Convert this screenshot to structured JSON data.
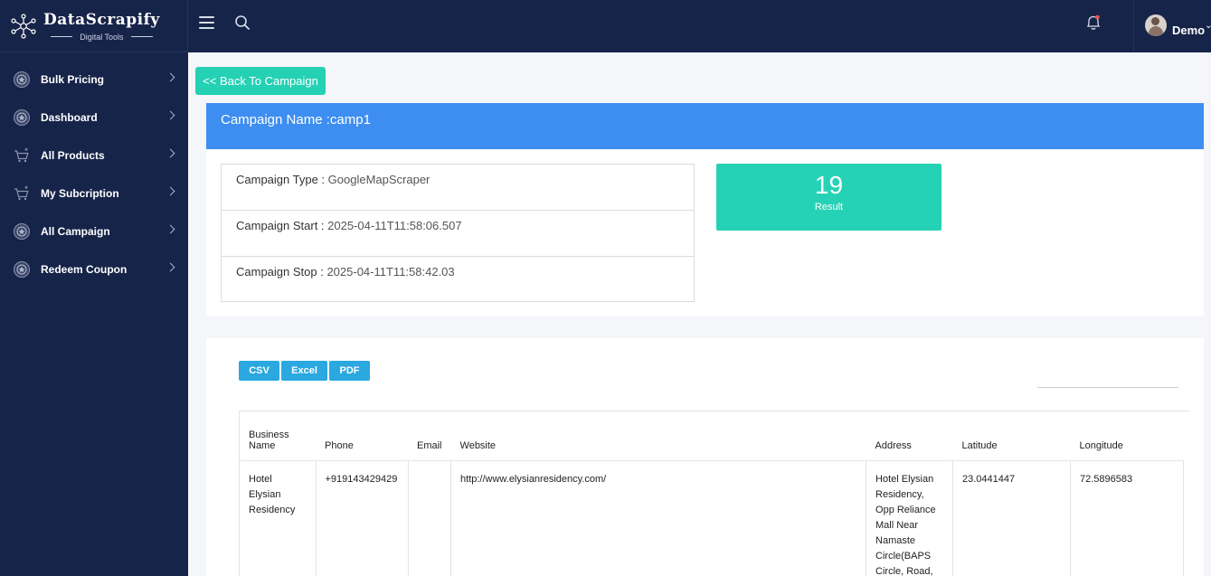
{
  "brand": {
    "name": "DataScrapify",
    "tagline": "Digital Tools"
  },
  "sidebar": {
    "items": [
      {
        "label": "Bulk Pricing",
        "icon": "badge-icon"
      },
      {
        "label": "Dashboard",
        "icon": "badge-icon"
      },
      {
        "label": "All Products",
        "icon": "cart-icon"
      },
      {
        "label": "My Subcription",
        "icon": "cart-icon"
      },
      {
        "label": "All Campaign",
        "icon": "badge-icon"
      },
      {
        "label": "Redeem Coupon",
        "icon": "badge-icon"
      }
    ]
  },
  "topbar": {
    "user_name": "Demo"
  },
  "back_button": "<< Back To Campaign",
  "campaign": {
    "header": "Campaign Name :camp1",
    "type_label": "Campaign Type : ",
    "type_value": "GoogleMapScraper",
    "start_label": "Campaign Start : ",
    "start_value": "2025-04-11T11:58:06.507",
    "stop_label": "Campaign Stop : ",
    "stop_value": "2025-04-11T11:58:42.03",
    "result_count": "19",
    "result_label": "Result"
  },
  "exports": [
    "CSV",
    "Excel",
    "PDF"
  ],
  "table": {
    "columns": [
      "Business Name",
      "Phone",
      "Email",
      "Website",
      "Address",
      "Latitude",
      "Longitude"
    ],
    "rows": [
      {
        "business_name": "Hotel Elysian Residency",
        "phone": "+919143429429",
        "email": "",
        "website": "http://www.elysianresidency.com/",
        "address": "Hotel Elysian Residency, Opp Reliance Mall Near Namaste Circle(BAPS Circle, Road,",
        "latitude": "23.0441447",
        "longitude": "72.5896583"
      }
    ]
  },
  "colors": {
    "sidebar_bg": "#172449",
    "accent_teal": "#24d1b4",
    "header_blue": "#3d8ef0",
    "export_blue": "#2aa8df"
  }
}
